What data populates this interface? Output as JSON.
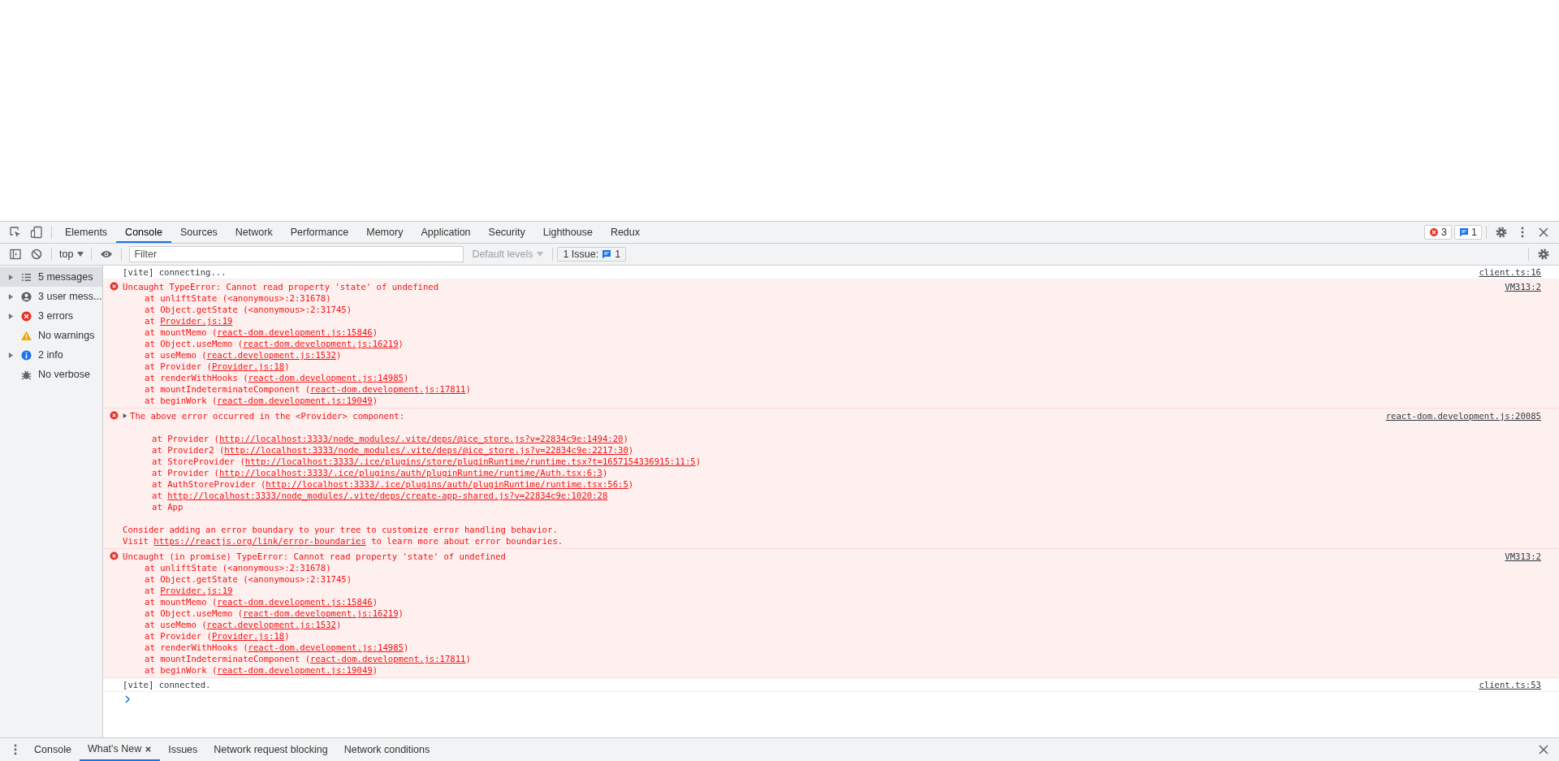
{
  "tabs": [
    {
      "label": "Elements",
      "selected": false
    },
    {
      "label": "Console",
      "selected": true
    },
    {
      "label": "Sources",
      "selected": false
    },
    {
      "label": "Network",
      "selected": false
    },
    {
      "label": "Performance",
      "selected": false
    },
    {
      "label": "Memory",
      "selected": false
    },
    {
      "label": "Application",
      "selected": false
    },
    {
      "label": "Security",
      "selected": false
    },
    {
      "label": "Lighthouse",
      "selected": false
    },
    {
      "label": "Redux",
      "selected": false
    }
  ],
  "counters": {
    "errors": "3",
    "issues": "1"
  },
  "toolbar": {
    "context": "top",
    "filter_placeholder": "Filter",
    "levels": "Default levels",
    "issues_label": "1 Issue:",
    "issues_count": "1"
  },
  "sidebar": [
    {
      "kind": "messages",
      "label": "5 messages",
      "expandable": true,
      "selected": true
    },
    {
      "kind": "user",
      "label": "3 user mess...",
      "expandable": true,
      "selected": false
    },
    {
      "kind": "error",
      "label": "3 errors",
      "expandable": true,
      "selected": false
    },
    {
      "kind": "warning",
      "label": "No warnings",
      "expandable": false,
      "selected": false
    },
    {
      "kind": "info",
      "label": "2 info",
      "expandable": true,
      "selected": false
    },
    {
      "kind": "verbose",
      "label": "No verbose",
      "expandable": false,
      "selected": false
    }
  ],
  "messages": [
    {
      "kind": "log",
      "text": "[vite] connecting...",
      "source": "client.ts:16"
    },
    {
      "kind": "error",
      "expandable": false,
      "text": "Uncaught TypeError: Cannot read property 'state' of undefined",
      "source": "VM313:2",
      "frames": [
        {
          "before": "at unliftState (<anonymous>:2:31678)"
        },
        {
          "before": "at Object.getState (<anonymous>:2:31745)"
        },
        {
          "before": "at ",
          "link": "Provider.js:19"
        },
        {
          "before": "at mountMemo (",
          "link": "react-dom.development.js:15846",
          "after": ")"
        },
        {
          "before": "at Object.useMemo (",
          "link": "react-dom.development.js:16219",
          "after": ")"
        },
        {
          "before": "at useMemo (",
          "link": "react.development.js:1532",
          "after": ")"
        },
        {
          "before": "at Provider (",
          "link": "Provider.js:18",
          "after": ")"
        },
        {
          "before": "at renderWithHooks (",
          "link": "react-dom.development.js:14985",
          "after": ")"
        },
        {
          "before": "at mountIndeterminateComponent (",
          "link": "react-dom.development.js:17811",
          "after": ")"
        },
        {
          "before": "at beginWork (",
          "link": "react-dom.development.js:19049",
          "after": ")"
        }
      ]
    },
    {
      "kind": "error",
      "expandable": true,
      "text": "The above error occurred in the <Provider> component:",
      "source": "react-dom.development.js:20085",
      "frames": [
        {
          "before": "at Provider (",
          "link": "http://localhost:3333/node_modules/.vite/deps/@ice_store.js?v=22834c9e:1494:20",
          "after": ")"
        },
        {
          "before": "at Provider2 (",
          "link": "http://localhost:3333/node_modules/.vite/deps/@ice_store.js?v=22834c9e:2217:30",
          "after": ")"
        },
        {
          "before": "at StoreProvider (",
          "link": "http://localhost:3333/.ice/plugins/store/pluginRuntime/runtime.tsx?t=1657154336915:11:5",
          "after": ")"
        },
        {
          "before": "at Provider (",
          "link": "http://localhost:3333/.ice/plugins/auth/pluginRuntime/runtime/Auth.tsx:6:3",
          "after": ")"
        },
        {
          "before": "at AuthStoreProvider (",
          "link": "http://localhost:3333/.ice/plugins/auth/pluginRuntime/runtime.tsx:56:5",
          "after": ")"
        },
        {
          "before": "at ",
          "link": "http://localhost:3333/node_modules/.vite/deps/create-app-shared.js?v=22834c9e:1020:28"
        },
        {
          "before": "at App"
        }
      ],
      "notes": [
        {
          "before": "Consider adding an error boundary to your tree to customize error handling behavior."
        },
        {
          "before": "Visit ",
          "link": "https://reactjs.org/link/error-boundaries",
          "after": " to learn more about error boundaries."
        }
      ]
    },
    {
      "kind": "error",
      "expandable": false,
      "text": "Uncaught (in promise) TypeError: Cannot read property 'state' of undefined",
      "source": "VM313:2",
      "frames": [
        {
          "before": "at unliftState (<anonymous>:2:31678)"
        },
        {
          "before": "at Object.getState (<anonymous>:2:31745)"
        },
        {
          "before": "at ",
          "link": "Provider.js:19"
        },
        {
          "before": "at mountMemo (",
          "link": "react-dom.development.js:15846",
          "after": ")"
        },
        {
          "before": "at Object.useMemo (",
          "link": "react-dom.development.js:16219",
          "after": ")"
        },
        {
          "before": "at useMemo (",
          "link": "react.development.js:1532",
          "after": ")"
        },
        {
          "before": "at Provider (",
          "link": "Provider.js:18",
          "after": ")"
        },
        {
          "before": "at renderWithHooks (",
          "link": "react-dom.development.js:14985",
          "after": ")"
        },
        {
          "before": "at mountIndeterminateComponent (",
          "link": "react-dom.development.js:17811",
          "after": ")"
        },
        {
          "before": "at beginWork (",
          "link": "react-dom.development.js:19049",
          "after": ")"
        }
      ]
    },
    {
      "kind": "log",
      "text": "[vite] connected.",
      "source": "client.ts:53"
    }
  ],
  "drawer_tabs": [
    {
      "label": "Console",
      "selected": false,
      "closable": false
    },
    {
      "label": "What's New",
      "selected": true,
      "closable": true
    },
    {
      "label": "Issues",
      "selected": false,
      "closable": false
    },
    {
      "label": "Network request blocking",
      "selected": false,
      "closable": false
    },
    {
      "label": "Network conditions",
      "selected": false,
      "closable": false
    }
  ]
}
